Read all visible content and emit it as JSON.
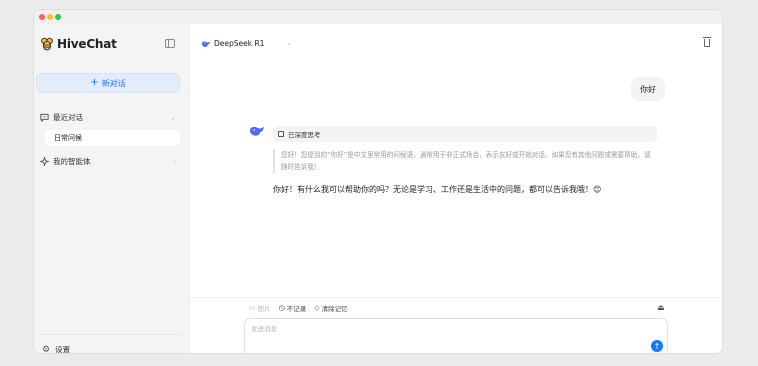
{
  "brand": {
    "name": "HiveChat",
    "logo_icon": "bee-logo"
  },
  "sidebar": {
    "new_chat": {
      "plus": "+",
      "label": "新对话"
    },
    "recent": {
      "label": "最近对话",
      "icon": "chat-bubble-icon",
      "chevron": "›"
    },
    "recent_items": [
      "日常问候"
    ],
    "agents": {
      "label": "我的智能体",
      "icon": "sparkle-icon",
      "chevron": "›"
    },
    "settings": {
      "label": "设置",
      "icon": "gear-icon"
    }
  },
  "header": {
    "model_name": "DeepSeek R1",
    "chevron": "⌄"
  },
  "conversation": {
    "user_message": "你好",
    "thinking_label": "已深度思考",
    "thinking_text": "您好！您提到的“你好”是中文里常用的问候语，通常用于非正式场合，表示友好或开始对话。如果您有其他问题或需要帮助，请随时告诉我！",
    "answer": "你好！有什么我可以帮助你的吗？无论是学习、工作还是生活中的问题，都可以告诉我哦！😊"
  },
  "composer": {
    "tools": {
      "image": "图片",
      "no_record": "不记录",
      "clear_memory": "清除记忆"
    },
    "placeholder": "发送消息",
    "send_icon": "↑"
  },
  "colors": {
    "accent": "#1677ff",
    "new_chat_bg": "#e3ecfb",
    "sidebar_bg": "#f4f4f4"
  }
}
